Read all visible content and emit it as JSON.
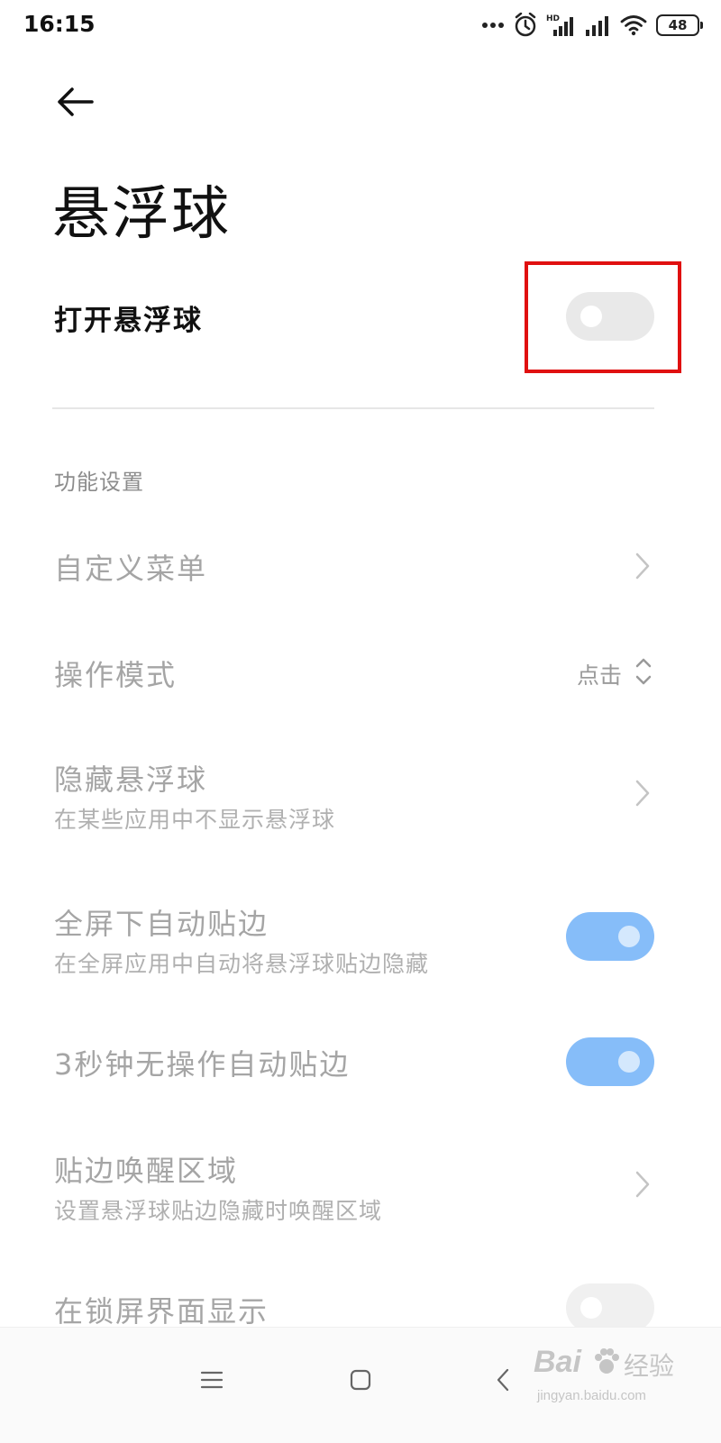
{
  "status_bar": {
    "time": "16:15",
    "battery_level": "48",
    "icons": [
      "more-dots-icon",
      "alarm-clock-icon",
      "hd-signal-icon",
      "signal-icon",
      "wifi-icon",
      "battery-icon"
    ]
  },
  "header": {
    "back_icon": "back-arrow-icon",
    "title": "悬浮球"
  },
  "main_toggle": {
    "label": "打开悬浮球",
    "on": false
  },
  "section": {
    "header": "功能设置",
    "items": [
      {
        "title": "自定义菜单",
        "subtitle": "",
        "control": "chevron"
      },
      {
        "title": "操作模式",
        "subtitle": "",
        "control": "select",
        "value": "点击"
      },
      {
        "title": "隐藏悬浮球",
        "subtitle": "在某些应用中不显示悬浮球",
        "control": "chevron"
      },
      {
        "title": "全屏下自动贴边",
        "subtitle": "在全屏应用中自动将悬浮球贴边隐藏",
        "control": "switch",
        "on": true
      },
      {
        "title": "3秒钟无操作自动贴边",
        "subtitle": "",
        "control": "switch",
        "on": true
      },
      {
        "title": "贴边唤醒区域",
        "subtitle": "设置悬浮球贴边隐藏时唤醒区域",
        "control": "chevron"
      },
      {
        "title": "在锁屏界面显示",
        "subtitle": "",
        "control": "switch",
        "on": false
      }
    ]
  },
  "nav_bar": {
    "icons": [
      "menu-icon",
      "home-icon",
      "back-icon"
    ]
  },
  "colors": {
    "highlight": "#e01010",
    "switch_on": "#86bdf9",
    "switch_off": "#e9e9e9",
    "disabled_text": "#a5a5a5"
  },
  "watermark": {
    "brand": "Bai",
    "brand_cn": "经验",
    "url": "jingyan.baidu.com"
  }
}
